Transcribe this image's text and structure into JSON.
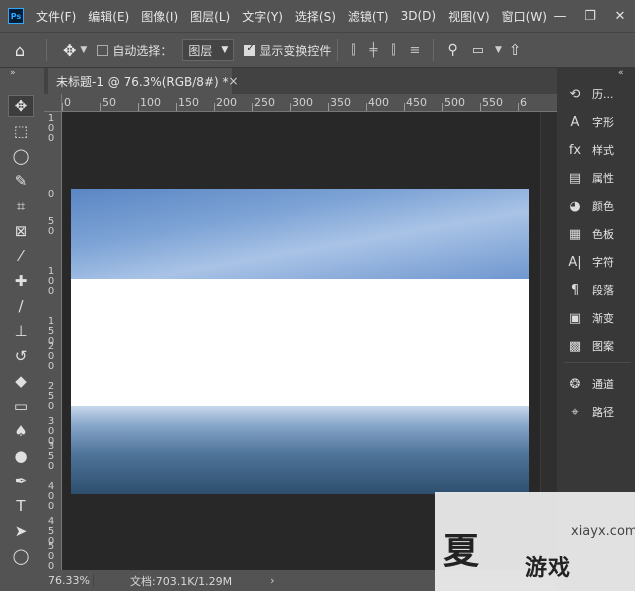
{
  "app": {
    "logo_text": "Ps",
    "menu": [
      "文件(F)",
      "编辑(E)",
      "图像(I)",
      "图层(L)",
      "文字(Y)",
      "选择(S)",
      "滤镜(T)",
      "3D(D)",
      "视图(V)",
      "窗口(W)"
    ],
    "window_controls": {
      "minimize": "—",
      "restore": "❐",
      "close": "✕"
    }
  },
  "options_bar": {
    "auto_select_label": "自动选择：",
    "auto_select_checked": false,
    "target_dropdown": "图层",
    "show_transform_label": "显示变换控件",
    "show_transform_checked": true
  },
  "document": {
    "tab_title": "未标题-1 @ 76.3%(RGB/8#) *",
    "close_glyph": "×"
  },
  "rulers": {
    "top_labels": [
      "0",
      "50",
      "100",
      "150",
      "200",
      "250",
      "300",
      "350",
      "400",
      "450",
      "500",
      "550",
      "6"
    ],
    "left_labels": [
      "1\n0\n0",
      "0",
      "5\n0",
      "1\n0\n0",
      "1\n5\n0",
      "2\n0\n0",
      "2\n5\n0",
      "3\n0\n0",
      "3\n5\n0",
      "4\n0\n0",
      "4\n5\n0",
      "5\n0\n0"
    ]
  },
  "status_bar": {
    "zoom": "76.33%",
    "doc_info": "文档:703.1K/1.29M",
    "arrow": "›"
  },
  "panels": [
    {
      "icon": "history-icon",
      "glyph": "⟲",
      "label": "历..."
    },
    {
      "icon": "character-icon",
      "glyph": "A",
      "label": "字形"
    },
    {
      "icon": "styles-icon",
      "glyph": "fx",
      "label": "样式"
    },
    {
      "icon": "properties-icon",
      "glyph": "▤",
      "label": "属性"
    },
    {
      "icon": "color-icon",
      "glyph": "◕",
      "label": "颜色"
    },
    {
      "icon": "swatches-icon",
      "glyph": "▦",
      "label": "色板"
    },
    {
      "icon": "type-icon",
      "glyph": "A|",
      "label": "字符"
    },
    {
      "icon": "paragraph-icon",
      "glyph": "¶",
      "label": "段落"
    },
    {
      "icon": "gradients-icon",
      "glyph": "▣",
      "label": "渐变"
    },
    {
      "icon": "patterns-icon",
      "glyph": "▩",
      "label": "图案"
    },
    {
      "icon": "channels-icon",
      "glyph": "❂",
      "label": "通道"
    },
    {
      "icon": "paths-icon",
      "glyph": "⌖",
      "label": "路径"
    }
  ],
  "tools": [
    {
      "name": "move-tool-icon",
      "glyph": "✥"
    },
    {
      "name": "marquee-tool-icon",
      "glyph": "⬚"
    },
    {
      "name": "lasso-tool-icon",
      "glyph": "◯"
    },
    {
      "name": "quick-select-tool-icon",
      "glyph": "✎"
    },
    {
      "name": "crop-tool-icon",
      "glyph": "⌗"
    },
    {
      "name": "frame-tool-icon",
      "glyph": "⊠"
    },
    {
      "name": "eyedropper-tool-icon",
      "glyph": "⁄"
    },
    {
      "name": "healing-brush-tool-icon",
      "glyph": "✚"
    },
    {
      "name": "brush-tool-icon",
      "glyph": "∕"
    },
    {
      "name": "stamp-tool-icon",
      "glyph": "⊥"
    },
    {
      "name": "history-brush-tool-icon",
      "glyph": "↺"
    },
    {
      "name": "eraser-tool-icon",
      "glyph": "◆"
    },
    {
      "name": "gradient-tool-icon",
      "glyph": "▭"
    },
    {
      "name": "blur-tool-icon",
      "glyph": "♠"
    },
    {
      "name": "dodge-tool-icon",
      "glyph": "●"
    },
    {
      "name": "pen-tool-icon",
      "glyph": "✒"
    },
    {
      "name": "type-tool-icon",
      "glyph": "T"
    },
    {
      "name": "path-select-tool-icon",
      "glyph": "➤"
    },
    {
      "name": "shape-tool-icon",
      "glyph": "◯"
    }
  ],
  "watermark": {
    "url": "xiayx.com",
    "name": "游戏"
  }
}
